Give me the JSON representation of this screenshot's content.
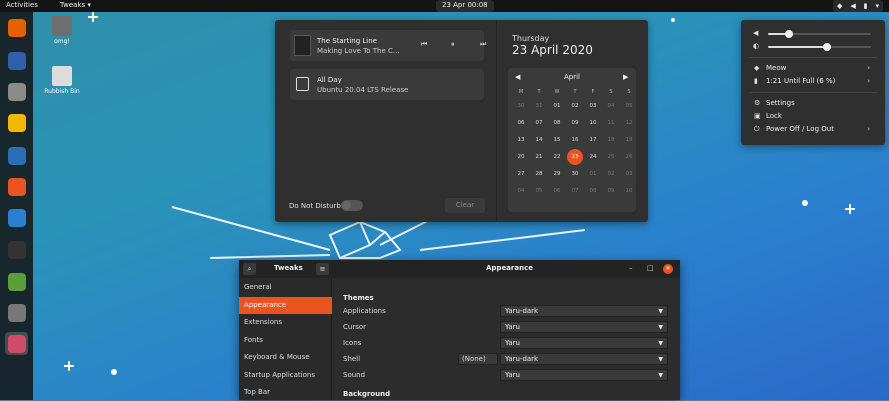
{
  "topbar": {
    "activities": "Activities",
    "app_menu": "Tweaks ▾",
    "clock": "23 Apr  00:08",
    "system_icons": [
      "network-icon",
      "volume-icon",
      "battery-icon",
      "chevron-down-icon"
    ]
  },
  "dock": {
    "items": [
      {
        "name": "firefox",
        "color": "#e66000"
      },
      {
        "name": "thunderbird",
        "color": "#2f5fa8"
      },
      {
        "name": "files",
        "color": "#8a8a8a"
      },
      {
        "name": "rhythmbox",
        "color": "#f2b700"
      },
      {
        "name": "writer",
        "color": "#2a6fb5"
      },
      {
        "name": "software",
        "color": "#e95420"
      },
      {
        "name": "help",
        "color": "#2a7fd0"
      },
      {
        "name": "terminal",
        "color": "#333333"
      },
      {
        "name": "extension",
        "color": "#5a9e3a"
      },
      {
        "name": "settings",
        "color": "#777777"
      },
      {
        "name": "tweaks",
        "color": "#d04a6a"
      }
    ]
  },
  "desktop": {
    "icons": [
      {
        "label": "omg!",
        "color": "#777777"
      },
      {
        "label": "Rubbish Bin",
        "color": "#dcdcdc"
      }
    ]
  },
  "notifications": {
    "media": {
      "title": "The Starting Line",
      "subtitle": "Making Love To The C..."
    },
    "event": {
      "title": "All Day",
      "subtitle": "Ubuntu 20.04 LTS Release"
    },
    "dnd_label": "Do Not Disturb",
    "clear_label": "Clear"
  },
  "calendar": {
    "weekday": "Thursday",
    "date": "23 April 2020",
    "month": "April",
    "dow": [
      "M",
      "T",
      "W",
      "T",
      "F",
      "S",
      "S"
    ],
    "weeks": [
      [
        "30",
        "31",
        "01",
        "02",
        "03",
        "04",
        "05"
      ],
      [
        "06",
        "07",
        "08",
        "09",
        "10",
        "11",
        "12"
      ],
      [
        "13",
        "14",
        "15",
        "16",
        "17",
        "18",
        "19"
      ],
      [
        "20",
        "21",
        "22",
        "23",
        "24",
        "25",
        "26"
      ],
      [
        "27",
        "28",
        "29",
        "30",
        "01",
        "02",
        "03"
      ],
      [
        "04",
        "05",
        "06",
        "07",
        "08",
        "09",
        "10"
      ]
    ],
    "today": "23"
  },
  "system_menu": {
    "volume_level": 0.2,
    "brightness_level": 0.57,
    "network_label": "Meow",
    "battery_label": "1:21 Until Full (6 %)",
    "settings_label": "Settings",
    "lock_label": "Lock",
    "power_label": "Power Off / Log Out"
  },
  "tweaks": {
    "app_title": "Tweaks",
    "window_title": "Appearance",
    "nav": [
      "General",
      "Appearance",
      "Extensions",
      "Fonts",
      "Keyboard & Mouse",
      "Startup Applications",
      "Top Bar"
    ],
    "selected_nav": "Appearance",
    "themes_heading": "Themes",
    "rows": [
      {
        "label": "Applications",
        "value": "Yaru-dark"
      },
      {
        "label": "Cursor",
        "value": "Yaru"
      },
      {
        "label": "Icons",
        "value": "Yaru"
      },
      {
        "label": "Shell",
        "value": "Yaru-dark"
      },
      {
        "label": "Sound",
        "value": "Yaru"
      }
    ],
    "shell_none": "(None)",
    "background_heading": "Background"
  }
}
